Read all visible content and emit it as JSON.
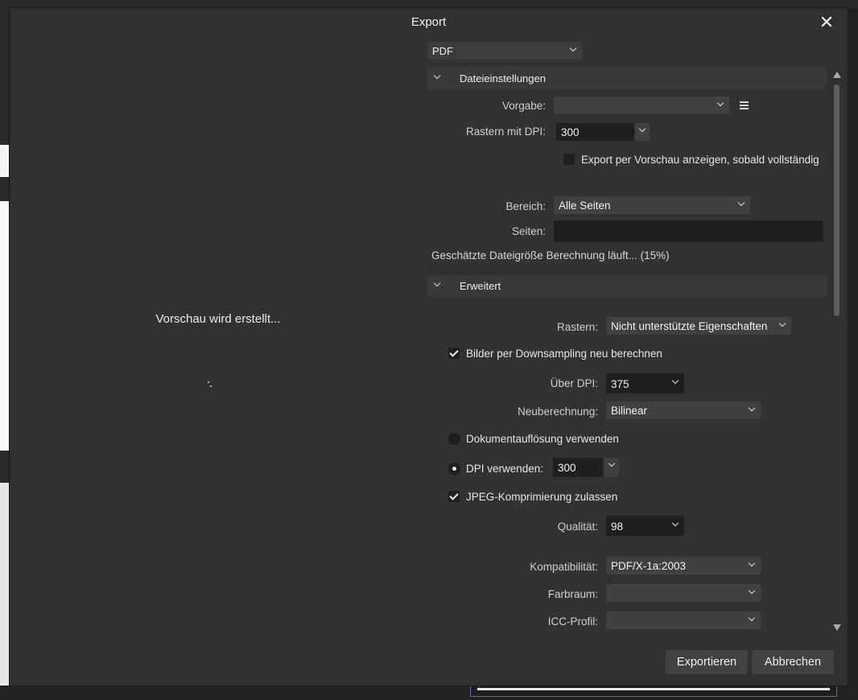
{
  "dialog": {
    "title": "Export",
    "format": "PDF",
    "preview_status": "Vorschau wird erstellt..."
  },
  "file_settings": {
    "section_label": "Dateieinstellungen",
    "preset_label": "Vorgabe:",
    "preset_value": "",
    "raster_dpi_label": "Rastern mit DPI:",
    "raster_dpi_value": "300",
    "show_preview_label": "Export per Vorschau anzeigen, sobald vollständig",
    "show_preview_checked": false,
    "area_label": "Bereich:",
    "area_value": "Alle Seiten",
    "pages_label": "Seiten:",
    "pages_value": "",
    "filesize_text": "Geschätzte Dateigröße Berechnung läuft... (15%)"
  },
  "advanced": {
    "section_label": "Erweitert",
    "rasterize_label": "Rastern:",
    "rasterize_value": "Nicht unterstützte Eigenschaften",
    "downsample_label": "Bilder per Downsampling neu berechnen",
    "downsample_checked": true,
    "above_dpi_label": "Über DPI:",
    "above_dpi_value": "375",
    "resample_label": "Neuberechnung:",
    "resample_value": "Bilinear",
    "use_doc_res_label": "Dokumentauflösung verwenden",
    "use_dpi_label": "DPI verwenden:",
    "use_dpi_value": "300",
    "jpeg_label": "JPEG-Komprimierung zulassen",
    "jpeg_checked": true,
    "quality_label": "Qualität:",
    "quality_value": "98",
    "compat_label": "Kompatibilität:",
    "compat_value": "PDF/X-1a:2003",
    "colorspace_label": "Farbraum:",
    "colorspace_value": "",
    "icc_label": "ICC-Profil:",
    "icc_value": ""
  },
  "buttons": {
    "export": "Exportieren",
    "cancel": "Abbrechen"
  },
  "colors": {
    "dialog_bg": "#313131",
    "field_bg": "#404040",
    "input_bg": "#1f1f1f"
  }
}
